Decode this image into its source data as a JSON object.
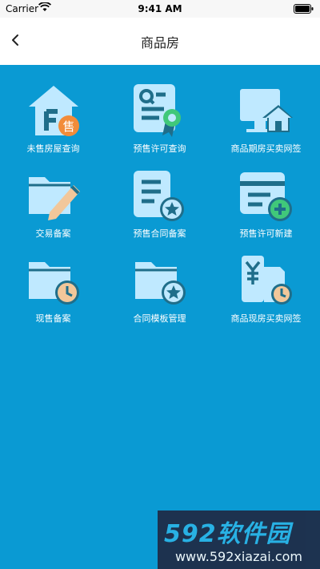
{
  "status_bar": {
    "carrier": "Carrier",
    "time": "9:41 AM"
  },
  "nav": {
    "title": "商品房"
  },
  "tiles": [
    {
      "label": "未售房屋查询",
      "icon": "house-sale-icon"
    },
    {
      "label": "预售许可查询",
      "icon": "certificate-icon"
    },
    {
      "label": "商品期房买卖网签",
      "icon": "computer-house-icon"
    },
    {
      "label": "交易备案",
      "icon": "folder-pen-icon"
    },
    {
      "label": "预售合同备案",
      "icon": "document-star-icon"
    },
    {
      "label": "预售许可新建",
      "icon": "card-add-icon"
    },
    {
      "label": "现售备案",
      "icon": "folder-clock-icon"
    },
    {
      "label": "合同模板管理",
      "icon": "folder-star-icon"
    },
    {
      "label": "商品现房买卖网签",
      "icon": "yuan-clock-icon"
    }
  ],
  "house_badge": "售",
  "watermark": {
    "brand": "592软件园",
    "url": "www.592xiazai.com"
  },
  "colors": {
    "background": "#0a9ad3",
    "icon_light": "#bfe9ff",
    "icon_dark": "#1f6e8a",
    "accent_orange": "#f28c3a",
    "accent_green": "#40c87a"
  }
}
